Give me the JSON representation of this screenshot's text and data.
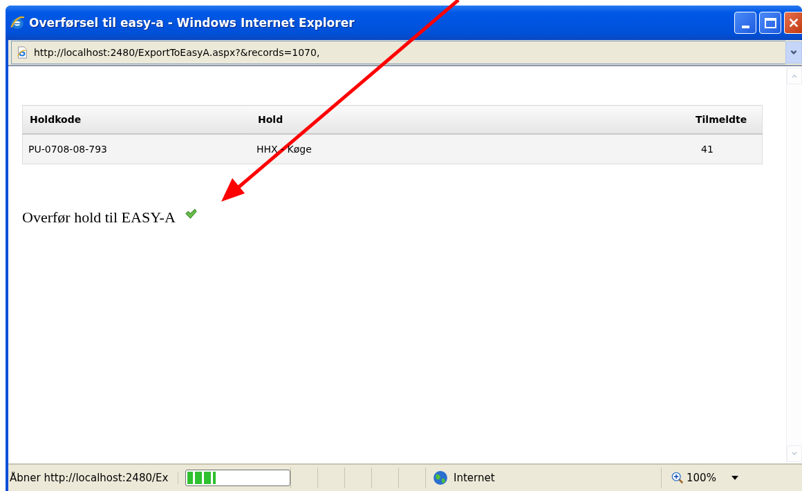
{
  "window": {
    "title": "Overførsel til easy-a - Windows Internet Explorer"
  },
  "address_bar": {
    "url": "http://localhost:2480/ExportToEasyA.aspx?&records=1070,"
  },
  "table": {
    "columns": [
      "Holdkode",
      "Hold",
      "Tilmeldte"
    ],
    "rows": [
      [
        "PU-0708-08-793",
        "HHX - Køge",
        "41"
      ]
    ]
  },
  "status_line": {
    "text": "Overfør hold til EASY-A",
    "done": true
  },
  "status_bar": {
    "message": "Åbner http://localhost:2480/Ex",
    "progress": {
      "level": 0.3
    },
    "zone": "Internet",
    "zoom": "100%"
  }
}
